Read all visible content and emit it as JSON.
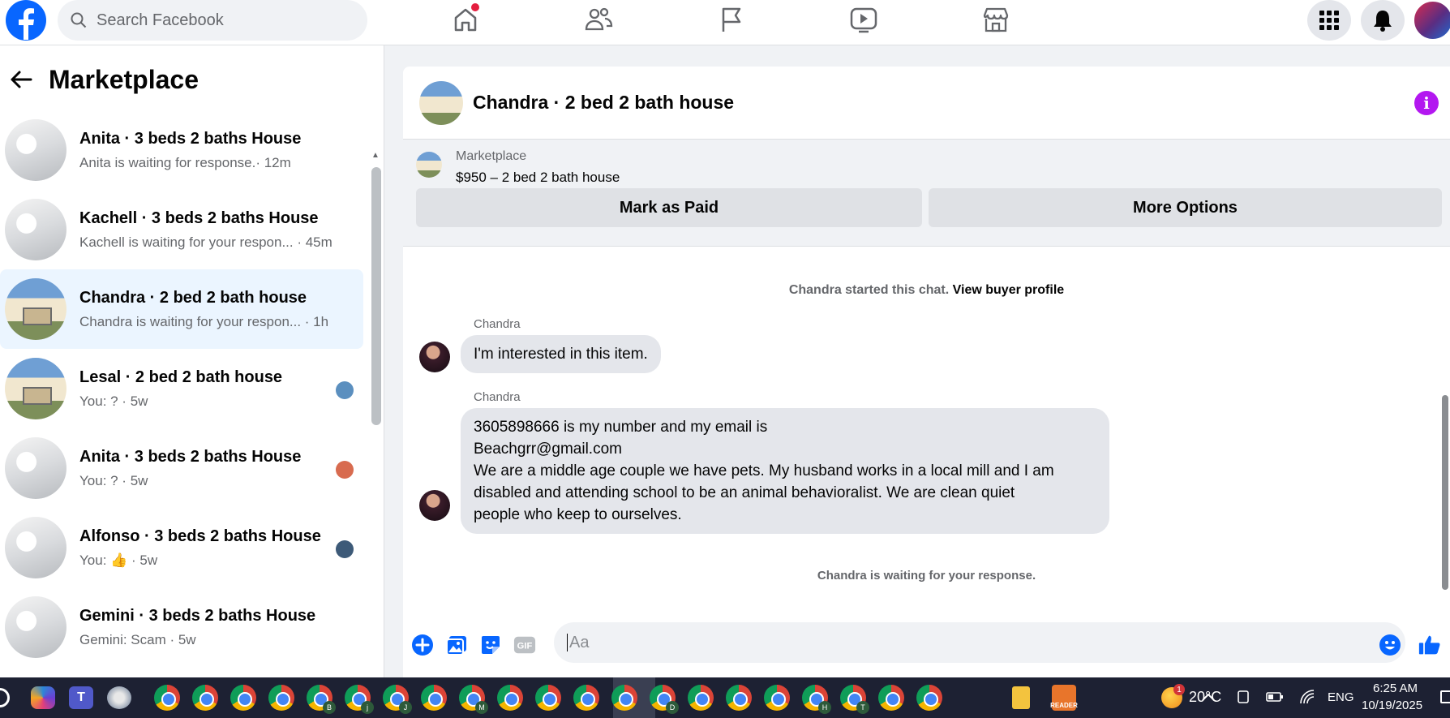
{
  "topnav": {
    "search_placeholder": "Search Facebook",
    "icons": [
      "home-icon",
      "friends-icon",
      "pages-flag-icon",
      "watch-video-icon",
      "marketplace-store-icon",
      "menu-grid-icon",
      "notifications-bell-icon"
    ],
    "home_has_notification": true
  },
  "sidebar": {
    "title": "Marketplace",
    "conversations": [
      {
        "title": "Anita · 3 beds 2 baths House",
        "subtitle": "Anita is waiting for response.· 12m",
        "thumb": "bath",
        "seen": ""
      },
      {
        "title": "Kachell · 3 beds 2 baths House",
        "subtitle": "Kachell is waiting for your respon... · 45m",
        "thumb": "bath",
        "seen": ""
      },
      {
        "title": "Chandra · 2 bed 2 bath house",
        "subtitle": "Chandra is waiting for your respon... · 1h",
        "thumb": "house",
        "seen": "",
        "active": true
      },
      {
        "title": "Lesal · 2 bed 2 bath house",
        "subtitle": "You: ? · 5w",
        "thumb": "house",
        "seen": "#5b8fbf"
      },
      {
        "title": "Anita · 3 beds 2 baths House",
        "subtitle": "You: ? · 5w",
        "thumb": "bath",
        "seen": "#d86b4f"
      },
      {
        "title": "Alfonso · 3 beds 2 baths House",
        "subtitle": "You: 👍 · 5w",
        "thumb": "bath",
        "seen": "#3d5a78"
      },
      {
        "title": "Gemini · 3 beds 2 baths House",
        "subtitle": "Gemini: Scam · 5w",
        "thumb": "bath",
        "seen": ""
      }
    ]
  },
  "chat": {
    "header_name": "Chandra · 2 bed 2 bath house",
    "listing": {
      "source": "Marketplace",
      "price_title": "$950 – 2 bed 2 bath house",
      "mark_paid": "Mark as Paid",
      "more_options": "More Options"
    },
    "started": "Chandra started this chat.",
    "view_profile": "View buyer profile",
    "messages": [
      {
        "sender": "Chandra",
        "text": "I'm interested in this item."
      },
      {
        "sender": "Chandra",
        "lines": [
          "3605898666 is my number and my email is",
          "Beachgrr@gmail.com",
          "We are a middle age couple we have pets. My husband works in a local mill and I am",
          "disabled and attending school to be an animal behavioralist. We are clean quiet",
          "people who keep to ourselves."
        ]
      }
    ],
    "waiting": "Chandra is waiting for your response.",
    "composer_placeholder": "Aa",
    "composer_icons": [
      "add-icon",
      "photo-icon",
      "sticker-icon",
      "gif-icon",
      "emoji-icon",
      "like-thumb-icon"
    ],
    "gif_label": "GIF"
  },
  "taskbar": {
    "weather": "20°C",
    "weather_badge": "1",
    "language": "ENG",
    "time": "6:25 AM",
    "date": "10/19/2025",
    "app_letters": [
      "",
      "",
      "",
      "",
      "B",
      "j",
      "J",
      "",
      "M",
      "",
      "",
      "",
      "",
      "D",
      "",
      "",
      "",
      "H",
      "T",
      "",
      "",
      ""
    ],
    "reader_label": "READER"
  }
}
